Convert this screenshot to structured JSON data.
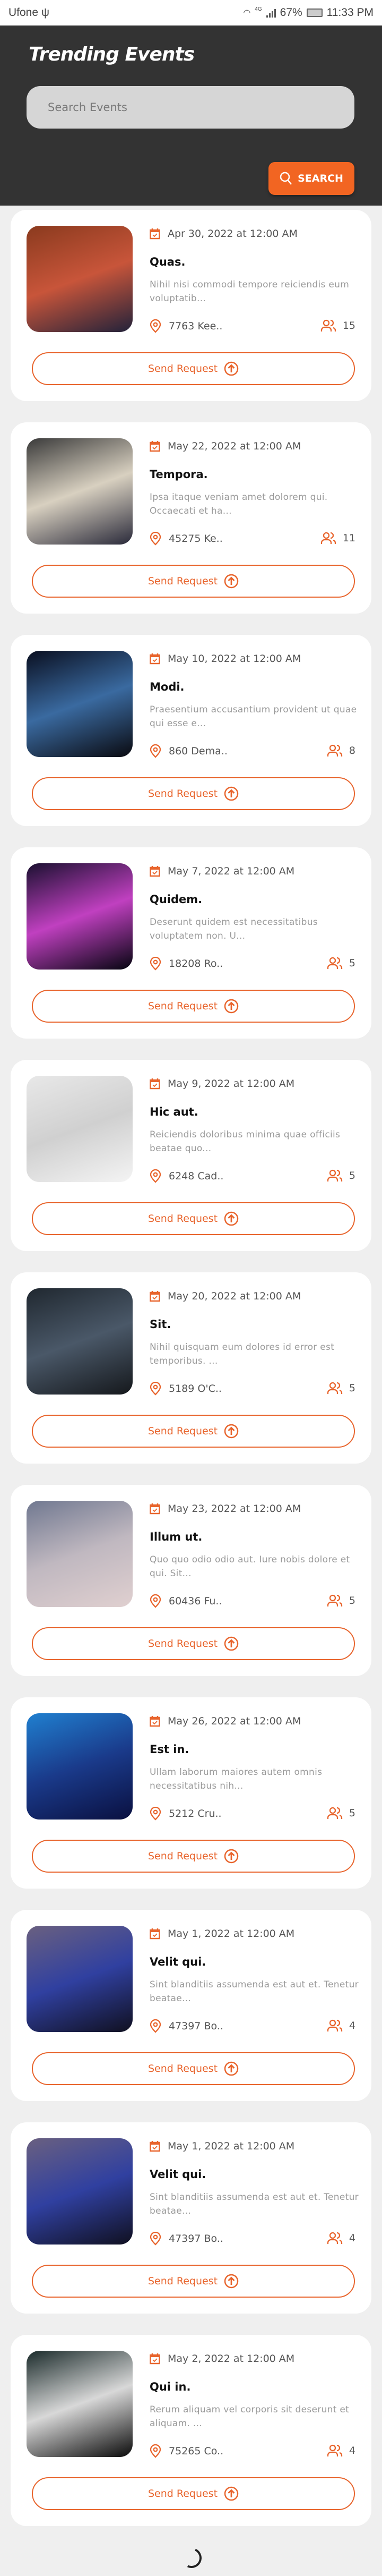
{
  "status_bar": {
    "carrier": "Ufone",
    "network": "4G",
    "battery": "67%",
    "time": "11:33 PM"
  },
  "header": {
    "title": "Trending Events",
    "search_placeholder": "Search Events",
    "search_button": "SEARCH"
  },
  "accent_color": "#f26522",
  "events": [
    {
      "date": "Apr 30, 2022 at 12:00 AM",
      "title": "Quas.",
      "description": "Nihil nisi commodi tempore reiciendis eum voluptatib...",
      "location": "7763 Kee..",
      "attendees": "15",
      "button": "Send Request",
      "thumb_colors": [
        "#8a3a1e",
        "#c8553a",
        "#22223a"
      ]
    },
    {
      "date": "May 22, 2022 at 12:00 AM",
      "title": "Tempora.",
      "description": "Ipsa itaque veniam amet dolorem qui. Occaecati et ha...",
      "location": "45275 Ke..",
      "attendees": "11",
      "button": "Send Request",
      "thumb_colors": [
        "#3a3a3a",
        "#d8d0c0",
        "#2a2a3a"
      ]
    },
    {
      "date": "May 10, 2022 at 12:00 AM",
      "title": "Modi.",
      "description": "Praesentium accusantium provident ut quae qui esse e...",
      "location": "860 Dema..",
      "attendees": "8",
      "button": "Send Request",
      "thumb_colors": [
        "#0a0f20",
        "#3a6aa0",
        "#0a0a10"
      ]
    },
    {
      "date": "May 7, 2022 at 12:00 AM",
      "title": "Quidem.",
      "description": "Deserunt quidem est necessitatibus voluptatem non. U...",
      "location": "18208 Ro..",
      "attendees": "5",
      "button": "Send Request",
      "thumb_colors": [
        "#1a1030",
        "#c040c0",
        "#050510"
      ]
    },
    {
      "date": "May 9, 2022 at 12:00 AM",
      "title": "Hic aut.",
      "description": "Reiciendis doloribus minima quae officiis beatae quo...",
      "location": "6248 Cad..",
      "attendees": "5",
      "button": "Send Request",
      "thumb_colors": [
        "#e8e8e8",
        "#d0d0d0",
        "#f4f4f4"
      ]
    },
    {
      "date": "May 20, 2022 at 12:00 AM",
      "title": "Sit.",
      "description": "Nihil quisquam eum dolores id error est temporibus. ...",
      "location": "5189 O'C..",
      "attendees": "5",
      "button": "Send Request",
      "thumb_colors": [
        "#202830",
        "#4a5868",
        "#15181c"
      ]
    },
    {
      "date": "May 23, 2022 at 12:00 AM",
      "title": "Illum ut.",
      "description": "Quo quo odio odio aut. Iure nobis dolore et qui. Sit...",
      "location": "60436 Fu..",
      "attendees": "5",
      "button": "Send Request",
      "thumb_colors": [
        "#707890",
        "#c0b8c0",
        "#e0d0d0"
      ]
    },
    {
      "date": "May 26, 2022 at 12:00 AM",
      "title": "Est in.",
      "description": "Ullam laborum maiores autem omnis necessitatibus nih...",
      "location": "5212 Cru..",
      "attendees": "5",
      "button": "Send Request",
      "thumb_colors": [
        "#2080d0",
        "#1a3a8a",
        "#0a1040"
      ]
    },
    {
      "date": "May 1, 2022 at 12:00 AM",
      "title": "Velit qui.",
      "description": "Sint blanditiis assumenda est aut et. Tenetur beatae...",
      "location": "47397 Bo..",
      "attendees": "4",
      "button": "Send Request",
      "thumb_colors": [
        "#6a6080",
        "#3040a0",
        "#101020"
      ]
    },
    {
      "date": "May 1, 2022 at 12:00 AM",
      "title": "Velit qui.",
      "description": "Sint blanditiis assumenda est aut et. Tenetur beatae...",
      "location": "47397 Bo..",
      "attendees": "4",
      "button": "Send Request",
      "thumb_colors": [
        "#6a6080",
        "#3040a0",
        "#101020"
      ]
    },
    {
      "date": "May 2, 2022 at 12:00 AM",
      "title": "Qui in.",
      "description": "Rerum aliquam vel corporis sit deserunt et aliquam. ...",
      "location": "75265 Co..",
      "attendees": "4",
      "button": "Send Request",
      "thumb_colors": [
        "#1a2a2a",
        "#d8d8d8",
        "#0a0a0a"
      ]
    }
  ]
}
